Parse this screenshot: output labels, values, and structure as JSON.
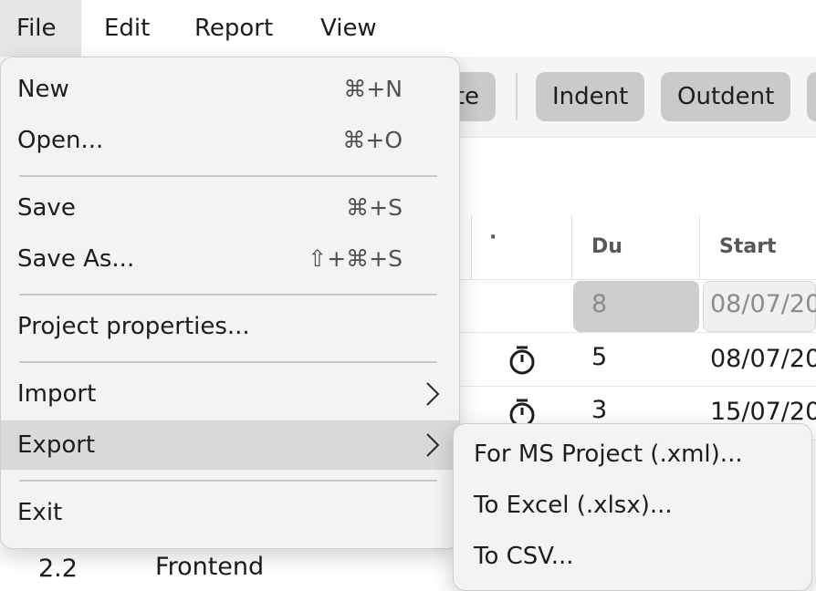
{
  "menubar": {
    "items": [
      "File",
      "Edit",
      "Report",
      "View"
    ]
  },
  "toolbar": {
    "partial_label": "te",
    "indent_label": "Indent",
    "outdent_label": "Outdent"
  },
  "grid": {
    "columns": {
      "dot": "·",
      "duration": "Du",
      "start": "Start"
    },
    "rows": [
      {
        "duration": "8",
        "start": "08/07/20"
      },
      {
        "duration": "5",
        "start": "08/07/20"
      },
      {
        "duration": "3",
        "start": "15/07/20"
      }
    ],
    "bottom_row": {
      "id": "2.2",
      "name": "Frontend"
    }
  },
  "file_menu": {
    "new": {
      "label": "New",
      "shortcut": "⌘+N"
    },
    "open": {
      "label": "Open...",
      "shortcut": "⌘+O"
    },
    "save": {
      "label": "Save",
      "shortcut": "⌘+S"
    },
    "save_as": {
      "label": "Save As...",
      "shortcut": "⇧+⌘+S"
    },
    "project_properties": {
      "label": "Project properties..."
    },
    "import": {
      "label": "Import"
    },
    "export": {
      "label": "Export"
    },
    "exit": {
      "label": "Exit"
    }
  },
  "export_submenu": {
    "items": [
      "For MS Project (.xml)...",
      "To Excel (.xlsx)...",
      "To CSV..."
    ]
  },
  "colors": {
    "menu_bg": "#f3f3f3",
    "highlight": "#d9d9d9",
    "toolbar_button": "#c9cacb"
  },
  "icons": [
    "timer-icon",
    "chevron-right-icon"
  ]
}
